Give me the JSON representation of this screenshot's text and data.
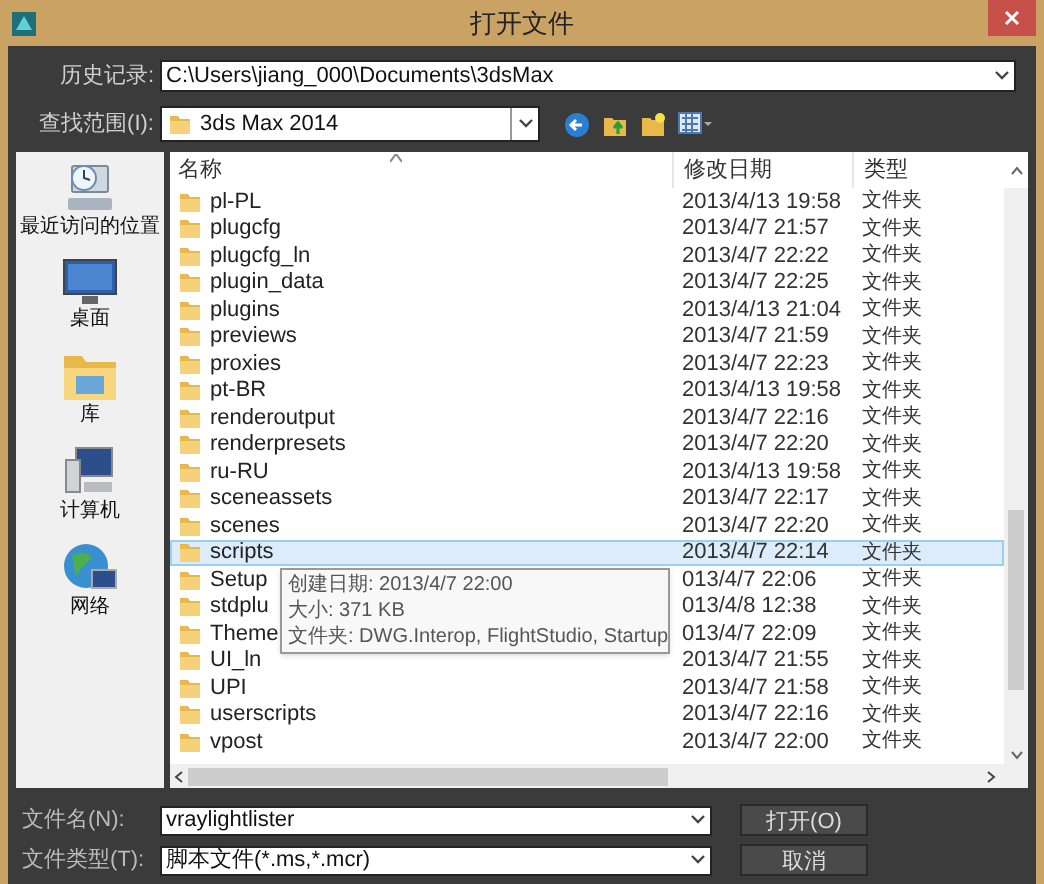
{
  "window": {
    "title": "打开文件"
  },
  "history": {
    "label": "历史记录:",
    "value": "C:\\Users\\jiang_000\\Documents\\3dsMax"
  },
  "look_in": {
    "label": "查找范围(I):",
    "value": "3ds Max 2014"
  },
  "sidebar": {
    "items": [
      {
        "label": "最近访问的位置",
        "kind": "recent"
      },
      {
        "label": "桌面",
        "kind": "desktop"
      },
      {
        "label": "库",
        "kind": "library"
      },
      {
        "label": "计算机",
        "kind": "computer"
      },
      {
        "label": "网络",
        "kind": "network"
      }
    ]
  },
  "file_list": {
    "columns": [
      "名称",
      "修改日期",
      "类型"
    ],
    "rows": [
      {
        "name": "pl-PL",
        "date": "2013/4/13 19:58",
        "type": "文件夹",
        "selected": false
      },
      {
        "name": "plugcfg",
        "date": "2013/4/7 21:57",
        "type": "文件夹",
        "selected": false
      },
      {
        "name": "plugcfg_ln",
        "date": "2013/4/7 22:22",
        "type": "文件夹",
        "selected": false
      },
      {
        "name": "plugin_data",
        "date": "2013/4/7 22:25",
        "type": "文件夹",
        "selected": false
      },
      {
        "name": "plugins",
        "date": "2013/4/13 21:04",
        "type": "文件夹",
        "selected": false
      },
      {
        "name": "previews",
        "date": "2013/4/7 21:59",
        "type": "文件夹",
        "selected": false
      },
      {
        "name": "proxies",
        "date": "2013/4/7 22:23",
        "type": "文件夹",
        "selected": false
      },
      {
        "name": "pt-BR",
        "date": "2013/4/13 19:58",
        "type": "文件夹",
        "selected": false
      },
      {
        "name": "renderoutput",
        "date": "2013/4/7 22:16",
        "type": "文件夹",
        "selected": false
      },
      {
        "name": "renderpresets",
        "date": "2013/4/7 22:20",
        "type": "文件夹",
        "selected": false
      },
      {
        "name": "ru-RU",
        "date": "2013/4/13 19:58",
        "type": "文件夹",
        "selected": false
      },
      {
        "name": "sceneassets",
        "date": "2013/4/7 22:17",
        "type": "文件夹",
        "selected": false
      },
      {
        "name": "scenes",
        "date": "2013/4/7 22:20",
        "type": "文件夹",
        "selected": false
      },
      {
        "name": "scripts",
        "date": "2013/4/7 22:14",
        "type": "文件夹",
        "selected": true
      },
      {
        "name": "Setup",
        "date": "013/4/7 22:06",
        "type": "文件夹",
        "selected": false
      },
      {
        "name": "stdplu",
        "date": "013/4/8 12:38",
        "type": "文件夹",
        "selected": false
      },
      {
        "name": "Theme",
        "date": "013/4/7 22:09",
        "type": "文件夹",
        "selected": false
      },
      {
        "name": "UI_ln",
        "date": "2013/4/7 21:55",
        "type": "文件夹",
        "selected": false
      },
      {
        "name": "UPI",
        "date": "2013/4/7 21:58",
        "type": "文件夹",
        "selected": false
      },
      {
        "name": "userscripts",
        "date": "2013/4/7 22:16",
        "type": "文件夹",
        "selected": false
      },
      {
        "name": "vpost",
        "date": "2013/4/7 22:00",
        "type": "文件夹",
        "selected": false
      }
    ]
  },
  "tooltip": {
    "lines": [
      "创建日期: 2013/4/7 22:00",
      "大小: 371 KB",
      "文件夹: DWG.Interop, FlightStudio, Startup"
    ]
  },
  "file_name": {
    "label": "文件名(N):",
    "value": "vraylightlister"
  },
  "file_type": {
    "label": "文件类型(T):",
    "value": "脚本文件(*.ms,*.mcr)"
  },
  "buttons": [
    "打开(O)",
    "取消"
  ]
}
